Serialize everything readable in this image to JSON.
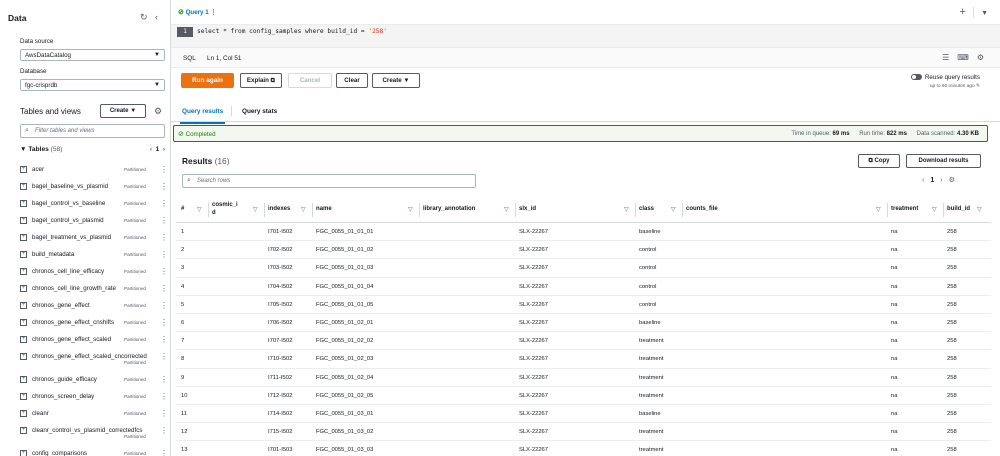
{
  "sidebar": {
    "title": "Data",
    "data_source_label": "Data source",
    "data_source_value": "AwsDataCatalog",
    "database_label": "Database",
    "database_value": "fgc-crisprdb",
    "tables_views_title": "Tables and views",
    "create_label": "Create",
    "filter_placeholder": "Filter tables and views",
    "tables_label": "Tables",
    "tables_count": "(58)",
    "tables_page": "1",
    "partition_label": "Partitioned",
    "tables": [
      "acer",
      "bagel_baseline_vs_plasmid",
      "bagel_control_vs_baseline",
      "bagel_control_vs_plasmid",
      "bagel_treatment_vs_plasmid",
      "build_metadata",
      "chronos_cell_line_efficacy",
      "chronos_cell_line_growth_rate",
      "chronos_gene_effect",
      "chronos_gene_effect_cnshifts",
      "chronos_gene_effect_scaled",
      "chronos_gene_effect_scaled_cncorrected",
      "chronos_guide_efficacy",
      "chronos_screen_delay",
      "cleanr",
      "cleanr_control_vs_plasmid_correctedfcs",
      "config_comparisons"
    ]
  },
  "editor": {
    "tab_label": "Query 1",
    "line_number": "1",
    "code_prefix": "select * from config_samples where build_id = ",
    "code_string": "'258'",
    "mode": "SQL",
    "position": "Ln 1, Col 51"
  },
  "actions": {
    "run_again": "Run again",
    "explain": "Explain",
    "cancel": "Cancel",
    "clear": "Clear",
    "create": "Create",
    "reuse_label": "Reuse query results",
    "reuse_sub": "up to 60 minutes ago"
  },
  "result_tabs": {
    "query_results": "Query results",
    "query_stats": "Query stats"
  },
  "status": {
    "completed": "Completed",
    "time_in_queue_label": "Time in queue:",
    "time_in_queue": "69 ms",
    "run_time_label": "Run time:",
    "run_time": "822 ms",
    "data_scanned_label": "Data scanned:",
    "data_scanned": "4.30 KB"
  },
  "results": {
    "title": "Results",
    "count": "(16)",
    "copy_label": "Copy",
    "download_label": "Download results",
    "search_placeholder": "Search rows",
    "page": "1",
    "columns": [
      "#",
      "cosmic_id",
      "indexes",
      "name",
      "library_annotation",
      "slx_id",
      "class",
      "counts_file",
      "treatment",
      "build_id"
    ],
    "rows": [
      [
        "1",
        "",
        "I701-I502",
        "FGC_0055_01_01_01",
        "",
        "SLX-22267",
        "baseline",
        "",
        "na",
        "258"
      ],
      [
        "2",
        "",
        "I702-I502",
        "FGC_0055_01_01_02",
        "",
        "SLX-22267",
        "control",
        "",
        "na",
        "258"
      ],
      [
        "3",
        "",
        "I703-I502",
        "FGC_0055_01_01_03",
        "",
        "SLX-22267",
        "control",
        "",
        "na",
        "258"
      ],
      [
        "4",
        "",
        "I704-I502",
        "FGC_0055_01_01_04",
        "",
        "SLX-22267",
        "control",
        "",
        "na",
        "258"
      ],
      [
        "5",
        "",
        "I705-I502",
        "FGC_0055_01_01_05",
        "",
        "SLX-22267",
        "control",
        "",
        "na",
        "258"
      ],
      [
        "6",
        "",
        "I706-I502",
        "FGC_0055_01_02_01",
        "",
        "SLX-22267",
        "baseline",
        "",
        "na",
        "258"
      ],
      [
        "7",
        "",
        "I707-I502",
        "FGC_0055_01_02_02",
        "",
        "SLX-22267",
        "treatment",
        "",
        "na",
        "258"
      ],
      [
        "8",
        "",
        "I710-I502",
        "FGC_0055_01_02_03",
        "",
        "SLX-22267",
        "treatment",
        "",
        "na",
        "258"
      ],
      [
        "9",
        "",
        "I711-I502",
        "FGC_0055_01_02_04",
        "",
        "SLX-22267",
        "treatment",
        "",
        "na",
        "258"
      ],
      [
        "10",
        "",
        "I712-I502",
        "FGC_0055_01_02_05",
        "",
        "SLX-22267",
        "treatment",
        "",
        "na",
        "258"
      ],
      [
        "11",
        "",
        "I714-I502",
        "FGC_0055_01_03_01",
        "",
        "SLX-22267",
        "baseline",
        "",
        "na",
        "258"
      ],
      [
        "12",
        "",
        "I715-I502",
        "FGC_0055_01_03_02",
        "",
        "SLX-22267",
        "treatment",
        "",
        "na",
        "258"
      ],
      [
        "13",
        "",
        "I701-I503",
        "FGC_0055_01_03_03",
        "",
        "SLX-22267",
        "treatment",
        "",
        "na",
        "258"
      ]
    ]
  },
  "colors": {
    "accent": "#0073bb",
    "primary_button": "#ec7211",
    "success": "#1d8102"
  }
}
